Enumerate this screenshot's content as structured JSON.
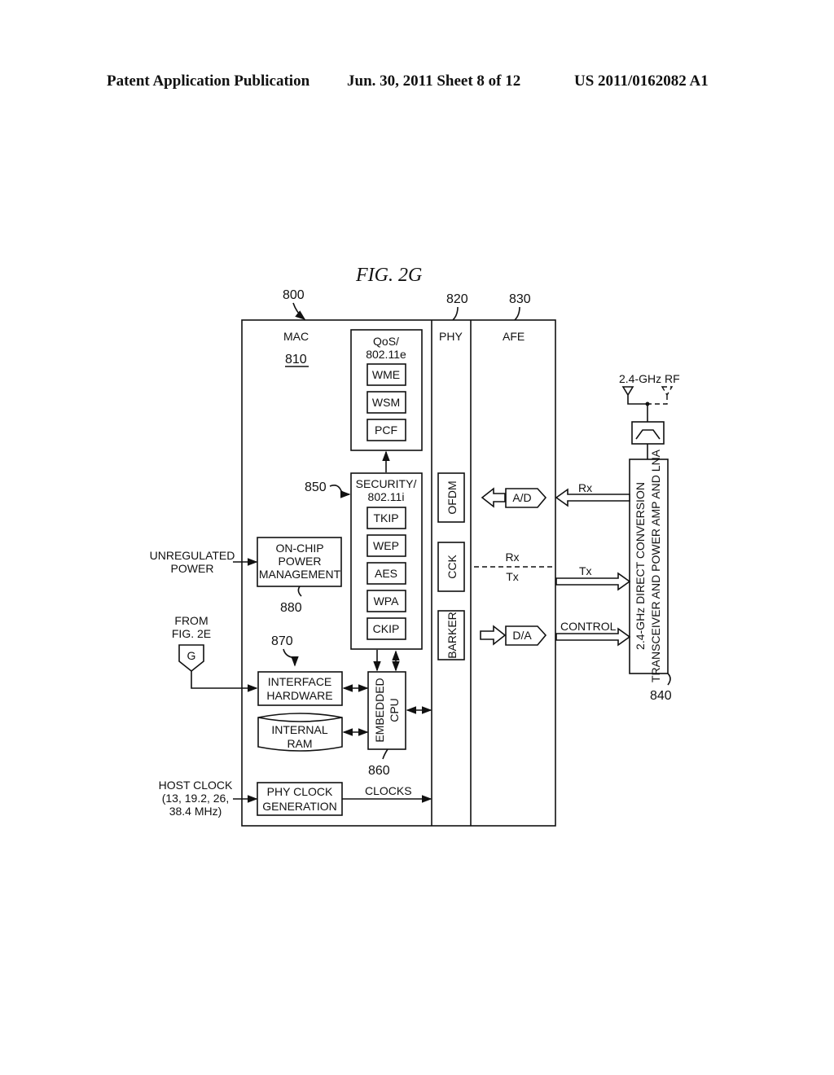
{
  "header": {
    "publication": "Patent Application Publication",
    "date_sheet": "Jun. 30, 2011   Sheet 8 of 12",
    "number": "US 2011/0162082 A1"
  },
  "figure": {
    "title": "FIG. 2G",
    "refs": {
      "outer": "800",
      "phy": "820",
      "afe": "830",
      "mac": "810",
      "security": "850",
      "cpu": "860",
      "iface": "870",
      "power": "880",
      "transceiver": "840"
    },
    "sections": {
      "mac": "MAC",
      "phy": "PHY",
      "afe": "AFE"
    },
    "qos": {
      "title1": "QoS/",
      "title2": "802.11e",
      "items": [
        "WME",
        "WSM",
        "PCF"
      ]
    },
    "security": {
      "title1": "SECURITY/",
      "title2": "802.11i",
      "items": [
        "TKIP",
        "WEP",
        "AES",
        "WPA",
        "CKIP"
      ]
    },
    "power": {
      "line1": "ON-CHIP",
      "line2": "POWER",
      "line3": "MANAGEMENT",
      "input1": "UNREGULATED",
      "input2": "POWER"
    },
    "from": {
      "line1": "FROM",
      "line2": "FIG. 2E",
      "connector": "G"
    },
    "iface": {
      "line1": "INTERFACE",
      "line2": "HARDWARE"
    },
    "ram": {
      "line1": "INTERNAL",
      "line2": "RAM"
    },
    "cpu": {
      "line1": "EMBEDDED",
      "line2": "CPU"
    },
    "clock": {
      "in1": "HOST CLOCK",
      "in2": "(13, 19.2, 26,",
      "in3": "38.4 MHz)",
      "box1": "PHY CLOCK",
      "box2": "GENERATION",
      "out": "CLOCKS"
    },
    "phy_blocks": [
      "OFDM",
      "CCK",
      "BARKER"
    ],
    "afe": {
      "ad": "A/D",
      "da": "D/A",
      "rx": "Rx",
      "tx": "Tx"
    },
    "rf": {
      "antenna": "2.4-GHz RF",
      "rx": "Rx",
      "tx": "Tx",
      "control": "CONTROL",
      "trans1": "2.4-GHz DIRECT CONVERSION",
      "trans2": "TRANSCEIVER AND POWER AMP AND LNA"
    }
  }
}
